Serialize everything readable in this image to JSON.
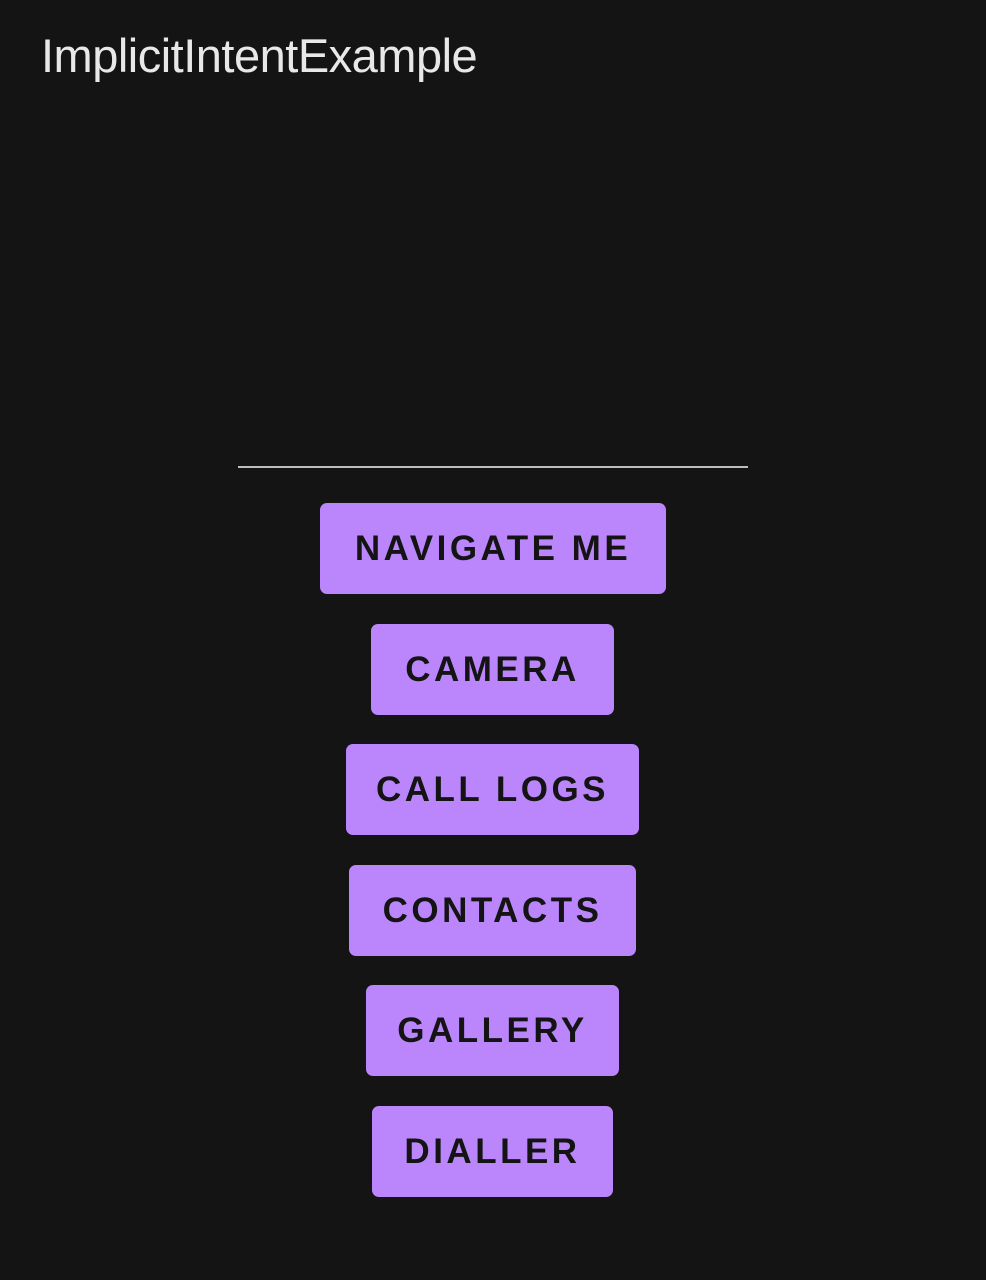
{
  "app_bar": {
    "title": "ImplicitIntentExample"
  },
  "input": {
    "value": "",
    "placeholder": ""
  },
  "buttons": {
    "navigate": "NAVIGATE ME",
    "camera": "CAMERA",
    "call_logs": "CALL LOGS",
    "contacts": "CONTACTS",
    "gallery": "GALLERY",
    "dialler": "DIALLER"
  },
  "colors": {
    "background": "#141414",
    "button": "#bb86fc",
    "button_text": "#141414",
    "title_text": "#e8e8e8",
    "input_underline": "#bdbdbd"
  }
}
